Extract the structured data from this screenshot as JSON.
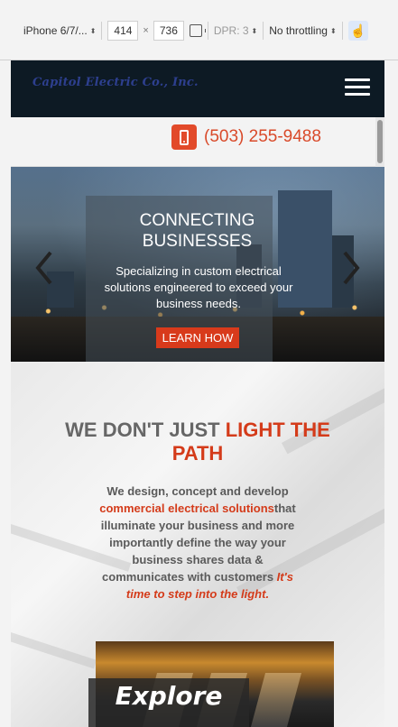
{
  "devtools": {
    "device": "iPhone 6/7/...",
    "width": "414",
    "height": "736",
    "times": "×",
    "dpr": "DPR: 3",
    "throttling": "No throttling"
  },
  "site": {
    "logo": "Capitol Electric Co., Inc.",
    "phone": "(503) 255-9488",
    "hero": {
      "title_line1": "CONNECTING",
      "title_line2": "BUSINESSES",
      "subtitle": "Specializing in custom electrical solutions engineered to exceed your business needs.",
      "button": "LEARN HOW"
    },
    "section": {
      "headline_part1": "WE DON'T JUST ",
      "headline_part2": "LIGHT THE PATH",
      "para_part1": "We design, concept and develop ",
      "para_highlight": "commercial electrical solutions",
      "para_part2": "that illuminate your business and more importantly define the way your business shares data & communicates with customers ",
      "para_em": "It's time to step into the light.",
      "explore": "Explore"
    }
  },
  "colors": {
    "accent": "#d43b1a",
    "header_bg": "#0d1a24",
    "logo": "#2d3f8e"
  },
  "icons": [
    "chevron-down-icon",
    "rotate-icon",
    "touch-icon",
    "hamburger-menu-icon",
    "phone-icon",
    "chevron-left-icon",
    "chevron-right-icon"
  ]
}
